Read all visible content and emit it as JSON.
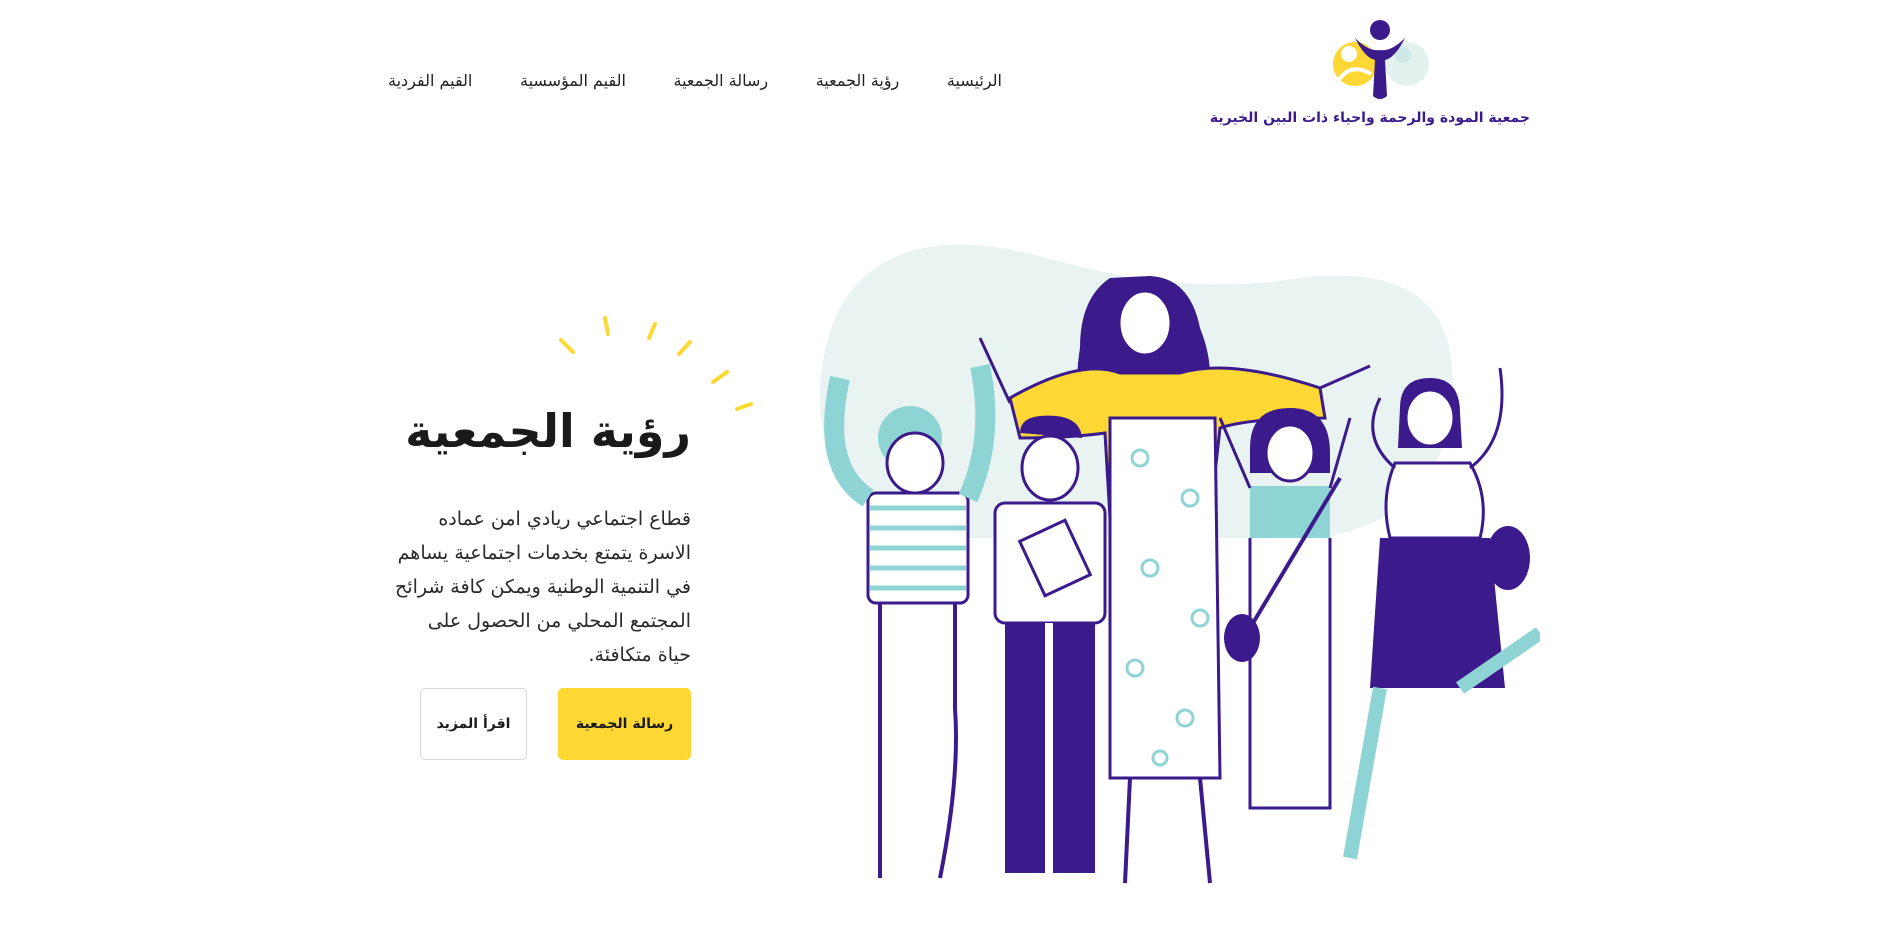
{
  "header": {
    "org_name": "جمعية المودة والرحمة واحياء ذات البين الخيرية",
    "nav": [
      "الرئيسية",
      "رؤية الجمعية",
      "رسالة الجمعية",
      "القيم المؤسسية",
      "القيم الفردية"
    ]
  },
  "hero": {
    "title": "رؤية الجمعية",
    "body": "قطاع اجتماعي ريادي امن عماده الاسرة يتمتع بخدمات اجتماعية يساهم في التنمية الوطنية ويمكن كافة شرائح المجتمع المحلي من الحصول على حياة متكافئة.",
    "primary_button": "رسالة الجمعية",
    "secondary_button": "اقرأ المزيد"
  },
  "colors": {
    "brand_purple": "#3b1a8c",
    "accent_yellow": "#fdd835",
    "mint": "#e8f3f2",
    "teal": "#8fd4d4"
  },
  "icons": {
    "logo": "family-logo-icon",
    "illustration": "group-of-people-illustration",
    "decoration": "sun-rays-icon"
  }
}
